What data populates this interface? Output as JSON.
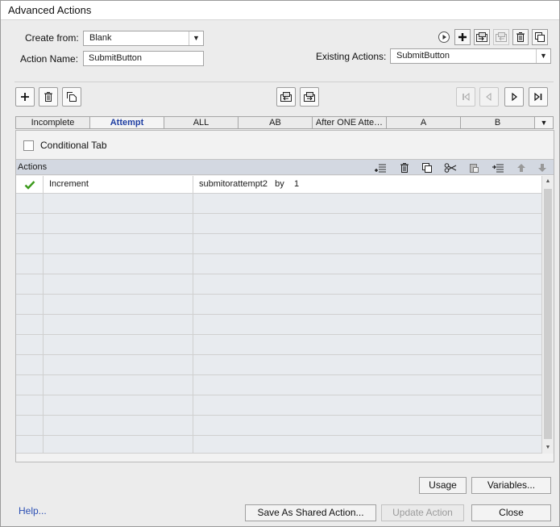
{
  "window": {
    "title": "Advanced Actions"
  },
  "form": {
    "create_from_label": "Create from:",
    "create_from_value": "Blank",
    "action_name_label": "Action Name:",
    "action_name_value": "SubmitButton",
    "existing_actions_label": "Existing Actions:",
    "existing_actions_value": "SubmitButton"
  },
  "header_icons": [
    "play-icon",
    "add-action-icon",
    "import-icon",
    "export-icon",
    "delete-icon",
    "duplicate-icon"
  ],
  "decision_toolbar_icons": [
    "add-decision-icon",
    "delete-decision-icon",
    "duplicate-decision-icon",
    "move-left-icon",
    "move-right-icon",
    "first-icon",
    "previous-icon",
    "next-icon",
    "last-icon"
  ],
  "tabs": [
    "Incomplete",
    "Attempt",
    "ALL",
    "AB",
    "After ONE Atte…",
    "A",
    "B"
  ],
  "active_tab": "Attempt",
  "conditional_tab_label": "Conditional Tab",
  "conditional_tab_checked": false,
  "actions": {
    "header_label": "Actions",
    "toolbar_icons": [
      "insert-row-icon",
      "delete-row-icon",
      "copy-row-icon",
      "cut-icon",
      "paste-icon",
      "insert-below-icon",
      "move-up-icon",
      "move-down-icon"
    ],
    "rows": [
      {
        "status": "valid",
        "action": "Increment",
        "target": "submitorattempt2   by    1"
      }
    ]
  },
  "buttons": {
    "usage": "Usage",
    "variables": "Variables...",
    "help": "Help...",
    "save_shared": "Save As Shared Action...",
    "update": "Update Action",
    "close": "Close"
  },
  "colors": {
    "active_tab": "#1f3fa3",
    "check": "#3c9a1c",
    "actions_bar": "#d3d8e1",
    "help_link": "#2b4fb4"
  }
}
